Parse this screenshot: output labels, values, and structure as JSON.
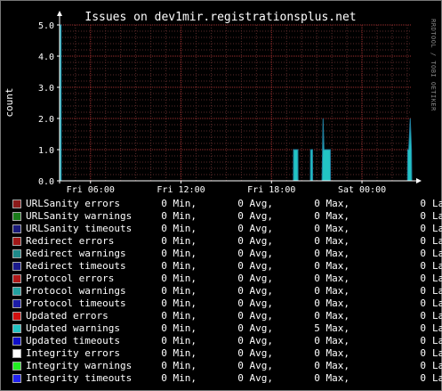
{
  "chart_data": {
    "type": "area",
    "title": "Issues on dev1mir.registrationsplus.net",
    "ylabel": "count",
    "xlabel": "",
    "watermark": "RRDTOOL / TOBI OETIKER",
    "ylim": [
      0,
      5.0
    ],
    "yticks": [
      "0.0",
      "1.0",
      "2.0",
      "3.0",
      "4.0",
      "5.0"
    ],
    "xlim_hours": [
      3.95,
      27.3
    ],
    "xticks": [
      {
        "label": "Fri 06:00",
        "hour": 6
      },
      {
        "label": "Fri 12:00",
        "hour": 12
      },
      {
        "label": "Fri 18:00",
        "hour": 18
      },
      {
        "label": "Sat 00:00",
        "hour": 24
      }
    ],
    "grid": true,
    "series": [
      {
        "name": "Updated warnings",
        "color": "#22c4c4",
        "points": [
          [
            3.95,
            5.0
          ],
          [
            4.05,
            5.0
          ],
          [
            4.06,
            0
          ],
          [
            19.45,
            0
          ],
          [
            19.46,
            1.0
          ],
          [
            19.75,
            1.0
          ],
          [
            19.76,
            0
          ],
          [
            20.58,
            0
          ],
          [
            20.59,
            1.0
          ],
          [
            20.72,
            1.0
          ],
          [
            20.73,
            0
          ],
          [
            21.35,
            0
          ],
          [
            21.42,
            2.0
          ],
          [
            21.48,
            1.0
          ],
          [
            21.9,
            1.0
          ],
          [
            21.91,
            0
          ],
          [
            27.02,
            0
          ],
          [
            27.03,
            1.0
          ],
          [
            27.1,
            1.0
          ],
          [
            27.2,
            2.0
          ],
          [
            27.28,
            1.0
          ],
          [
            27.3,
            0
          ]
        ]
      }
    ]
  },
  "legend": [
    {
      "label": "URLSanity errors",
      "color": "#8b1a1a",
      "min": "0 Min,",
      "avg": "0 Avg,",
      "max": "0 Max,",
      "last": "0",
      "last_label": "Last"
    },
    {
      "label": "URLSanity warnings",
      "color": "#1a7a1a",
      "min": "0 Min,",
      "avg": "0 Avg,",
      "max": "0 Max,",
      "last": "0",
      "last_label": "Last"
    },
    {
      "label": "URLSanity timeouts",
      "color": "#1a1a7a",
      "min": "0 Min,",
      "avg": "0 Avg,",
      "max": "0 Max,",
      "last": "0",
      "last_label": "Last"
    },
    {
      "label": "Redirect errors",
      "color": "#a01818",
      "min": "0 Min,",
      "avg": "0 Avg,",
      "max": "0 Max,",
      "last": "0",
      "last_label": "Last"
    },
    {
      "label": "Redirect warnings",
      "color": "#1f8a8a",
      "min": "0 Min,",
      "avg": "0 Avg,",
      "max": "0 Max,",
      "last": "0",
      "last_label": "Last"
    },
    {
      "label": "Redirect timeouts",
      "color": "#1a1a8a",
      "min": "0 Min,",
      "avg": "0 Avg,",
      "max": "0 Max,",
      "last": "0",
      "last_label": "Last"
    },
    {
      "label": "Protocol errors",
      "color": "#b01818",
      "min": "0 Min,",
      "avg": "0 Avg,",
      "max": "0 Max,",
      "last": "0",
      "last_label": "Last"
    },
    {
      "label": "Protocol warnings",
      "color": "#22a0a0",
      "min": "0 Min,",
      "avg": "0 Avg,",
      "max": "0 Max,",
      "last": "0",
      "last_label": "Last"
    },
    {
      "label": "Protocol timeouts",
      "color": "#1c1ca8",
      "min": "0 Min,",
      "avg": "0 Avg,",
      "max": "0 Max,",
      "last": "0",
      "last_label": "Last"
    },
    {
      "label": "Updated errors",
      "color": "#d01010",
      "min": "0 Min,",
      "avg": "0 Avg,",
      "max": "0 Max,",
      "last": "0",
      "last_label": "Last"
    },
    {
      "label": "Updated warnings",
      "color": "#22c4c4",
      "min": "0 Min,",
      "avg": "0 Avg,",
      "max": "5 Max,",
      "last": "0",
      "last_label": "Last"
    },
    {
      "label": "Updated timeouts",
      "color": "#1010c8",
      "min": "0 Min,",
      "avg": "0 Avg,",
      "max": "0 Max,",
      "last": "0",
      "last_label": "Last"
    },
    {
      "label": "Integrity errors",
      "color": "#ffffff",
      "min": "0 Min,",
      "avg": "0 Avg,",
      "max": "0 Max,",
      "last": "0",
      "last_label": "Last"
    },
    {
      "label": "Integrity warnings",
      "color": "#22ee22",
      "min": "0 Min,",
      "avg": "0 Avg,",
      "max": "0 Max,",
      "last": "0",
      "last_label": "Last"
    },
    {
      "label": "Integrity timeouts",
      "color": "#2222ee",
      "min": "0 Min,",
      "avg": "0 Avg,",
      "max": "0 Max,",
      "last": "0",
      "last_label": "Last"
    }
  ]
}
